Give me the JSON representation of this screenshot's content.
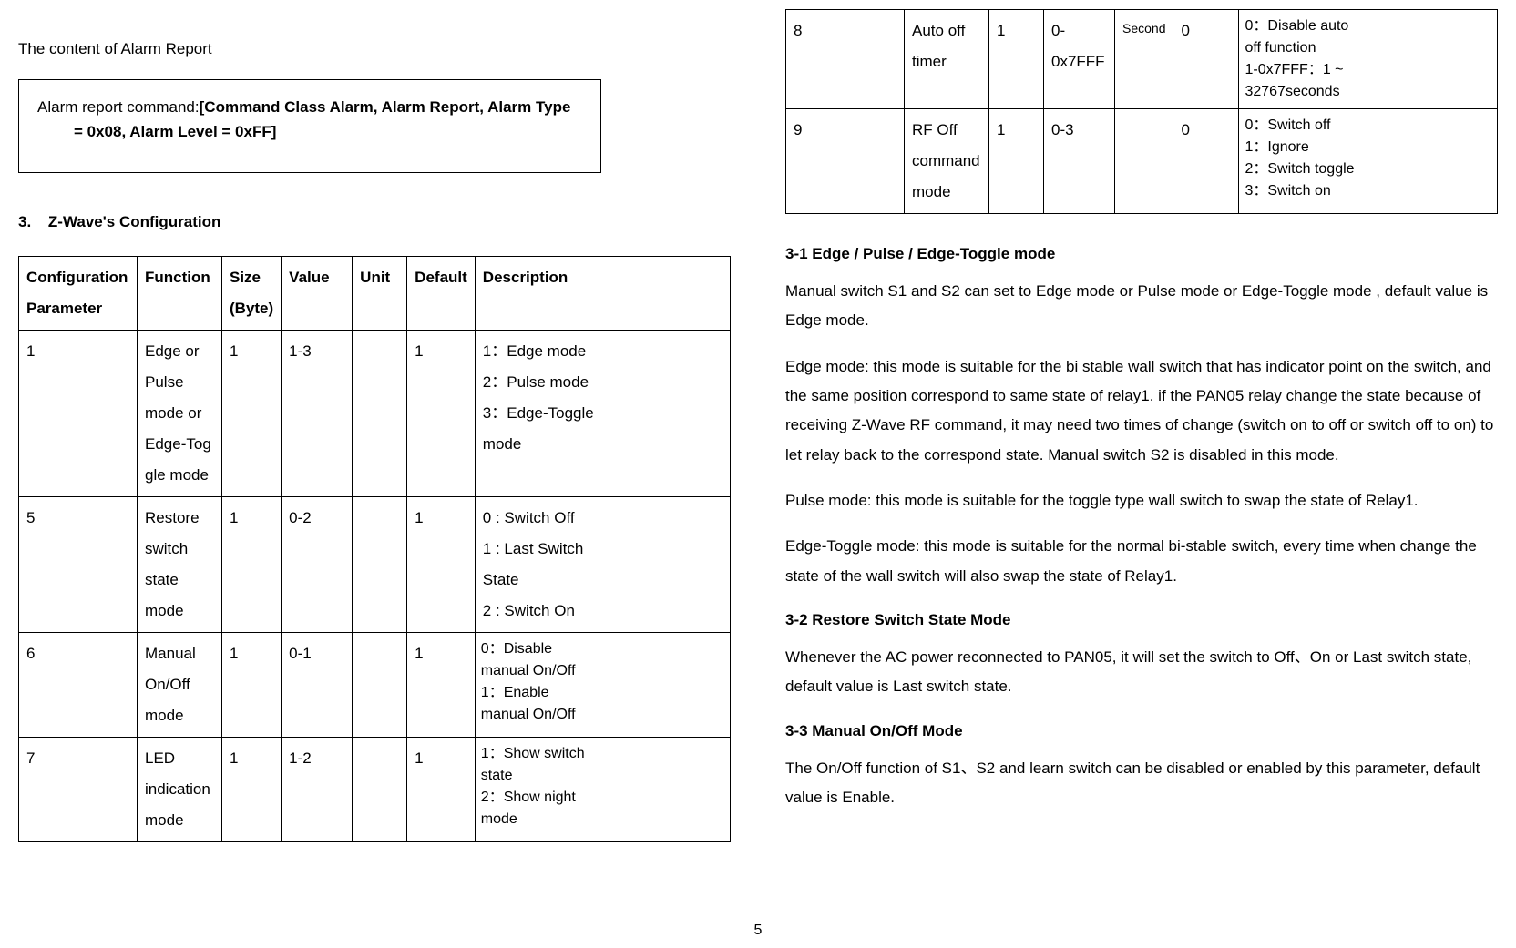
{
  "left": {
    "alarm_heading": "The content of Alarm Report",
    "alarm_cmd_prefix": "Alarm report command:",
    "alarm_cmd_bold_line1": "[Command Class Alarm, Alarm Report, Alarm Type",
    "alarm_cmd_bold_line2": "= 0x08, Alarm Level = 0xFF]",
    "section3_num": "3.",
    "section3_title": "Z-Wave's Configuration",
    "table_headers": {
      "col1a": "Configuration",
      "col1b": "Parameter",
      "col2": "Function",
      "col3a": "Size",
      "col3b": "(Byte)",
      "col4": "Value",
      "col5": "Unit",
      "col6": "Default",
      "col7": "Description"
    },
    "rows": [
      {
        "param": "1",
        "func": "Edge or Pulse mode or Edge-Tog gle mode",
        "size": "1",
        "value": "1-3",
        "unit": "",
        "def": "1",
        "desc": "1：Edge mode\n2：Pulse mode\n3：Edge-Toggle\n    mode"
      },
      {
        "param": "5",
        "func": "Restore switch state mode",
        "size": "1",
        "value": "0-2",
        "unit": "",
        "def": "1",
        "desc": "0 : Switch Off\n1 : Last Switch\n    State\n2 : Switch On"
      },
      {
        "param": "6",
        "func": "Manual On/Off mode",
        "size": "1",
        "value": "0-1",
        "unit": "",
        "def": "1",
        "desc": "0：Disable\n  manual On/Off\n1：Enable\n  manual On/Off"
      },
      {
        "param": "7",
        "func": "LED indication mode",
        "size": "1",
        "value": "1-2",
        "unit": "",
        "def": "1",
        "desc": "1：Show switch\n     state\n2：Show night\n     mode"
      }
    ]
  },
  "right": {
    "rows": [
      {
        "param": "8",
        "func": "Auto off timer",
        "size": "1",
        "value": "0-0x7FFF",
        "unit": "Second",
        "def": "0",
        "desc": "0：Disable auto\n     off function\n1-0x7FFF：1 ~\n  32767seconds"
      },
      {
        "param": "9",
        "func": "RF Off command mode",
        "size": "1",
        "value": "0-3",
        "unit": "",
        "def": "0",
        "desc": "0：Switch off\n1：Ignore\n2：Switch toggle\n3：Switch on"
      }
    ],
    "h31": "3-1 Edge / Pulse / Edge-Toggle mode",
    "p31a": "Manual switch S1 and S2 can set to Edge mode or Pulse mode or Edge-Toggle mode , default value is Edge mode.",
    "p31b": "Edge mode: this mode is suitable for the bi stable wall switch that has indicator point on the switch, and the same position correspond to same state of relay1. if the PAN05 relay change the state because of receiving Z-Wave RF command, it may need two times of change (switch on to off  or  switch off to on) to let relay back to the correspond state. Manual switch S2 is disabled in this mode.",
    "p31c": "Pulse mode: this mode is suitable for the toggle type wall switch to swap the state of Relay1.",
    "p31d": "Edge-Toggle mode: this mode is suitable for the normal bi-stable switch, every time when change the state of the wall switch will also swap the state of Relay1.",
    "h32": "3-2 Restore Switch State Mode",
    "p32": "Whenever the AC power reconnected to PAN05, it will set the switch to Off、On or Last switch state, default value is Last switch state.",
    "h33": "3-3 Manual On/Off Mode",
    "p33": "The On/Off function of S1、S2 and learn switch can be disabled or enabled by this parameter, default value is Enable."
  },
  "page_number": "5"
}
